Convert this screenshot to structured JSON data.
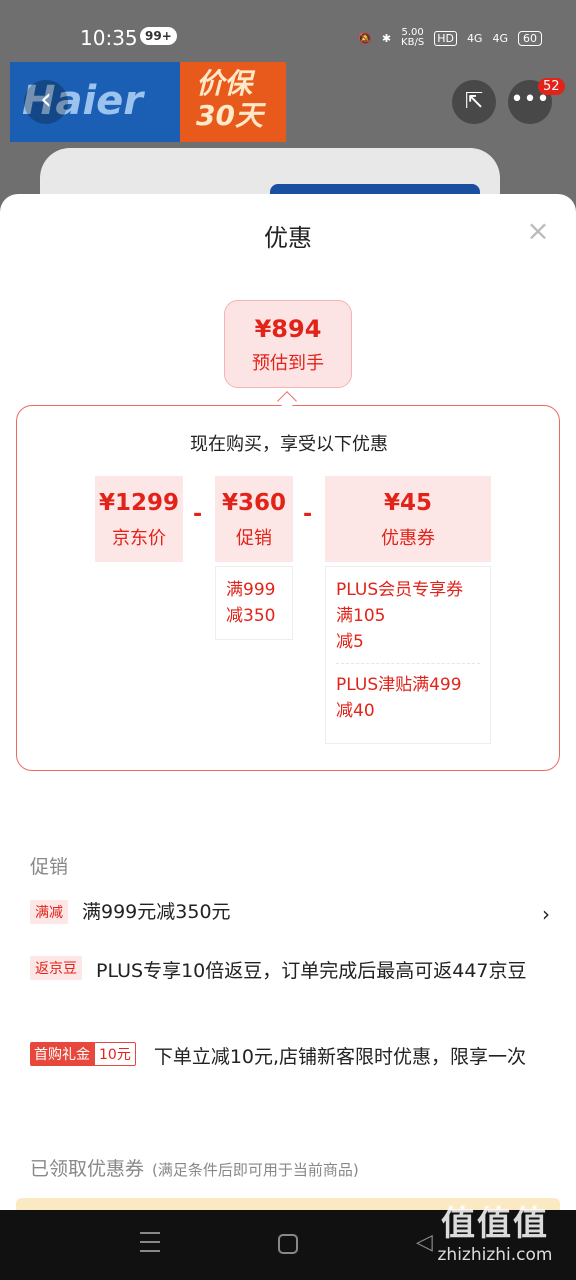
{
  "status_bar": {
    "time": "10:35",
    "notification_count": "99+",
    "net_speed_value": "5.00",
    "net_speed_unit": "KB/S",
    "hd": "HD",
    "signal_1": "4G",
    "signal_2": "4G",
    "battery": "60"
  },
  "background": {
    "brand": "Haier",
    "price_guard": "价保\n30天",
    "more_badge": "52"
  },
  "sheet": {
    "title": "优惠",
    "estimate": {
      "amount": "¥894",
      "label": "预估到手"
    },
    "calc_header": "现在购买，享受以下优惠",
    "items": [
      {
        "amount": "¥1299",
        "label": "京东价"
      },
      {
        "amount": "¥360",
        "label": "促销"
      },
      {
        "amount": "¥45",
        "label": "优惠券"
      }
    ],
    "operator": "-",
    "promo_detail": [
      "满999",
      "减350"
    ],
    "coupon_details": [
      [
        "PLUS会员专享券",
        "满105",
        "减5"
      ],
      [
        "PLUS津贴满499",
        "减40"
      ]
    ]
  },
  "promotions": {
    "title": "促销",
    "rows": [
      {
        "tag": "满减",
        "text": "满999元减350元"
      },
      {
        "tag": "返京豆",
        "text": "PLUS专享10倍返豆，订单完成后最高可返447京豆"
      },
      {
        "tag_a": "首购礼金",
        "tag_b": "10元",
        "text": "下单立减10元,店铺新客限时优惠，限享一次"
      }
    ],
    "chevron": "›"
  },
  "claimed": {
    "title": "已领取优惠券",
    "subtitle": "(满足条件后即可用于当前商品)"
  },
  "watermark": {
    "logo": "值值值",
    "site": "zhizhizhi.com"
  }
}
